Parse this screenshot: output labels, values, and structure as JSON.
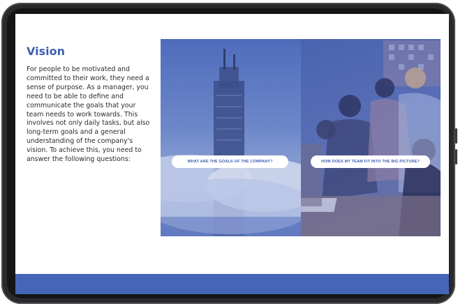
{
  "slide": {
    "title": "Vision",
    "body": "For people to be motivated and committed to their work, they need a sense of purpose. As a manager, you need to be able to define and communicate the goals that your team needs to work towards. This involves not only daily tasks, but also long-term goals and a general understanding of the company's vision. To achieve this, you need to answer the following questions:",
    "questions": [
      {
        "label": "WHAT ARE THE GOALS OF THE COMPANY?"
      },
      {
        "label": "HOW DOES MY TEAM FIT INTO THE BIG PICTURE?"
      }
    ]
  },
  "colors": {
    "accent": "#3f5fb0",
    "footer": "#4566b8",
    "frame": "#2a2a2c"
  },
  "icons": {
    "left_image": "skyscraper-clouds-image",
    "right_image": "team-meeting-image"
  }
}
